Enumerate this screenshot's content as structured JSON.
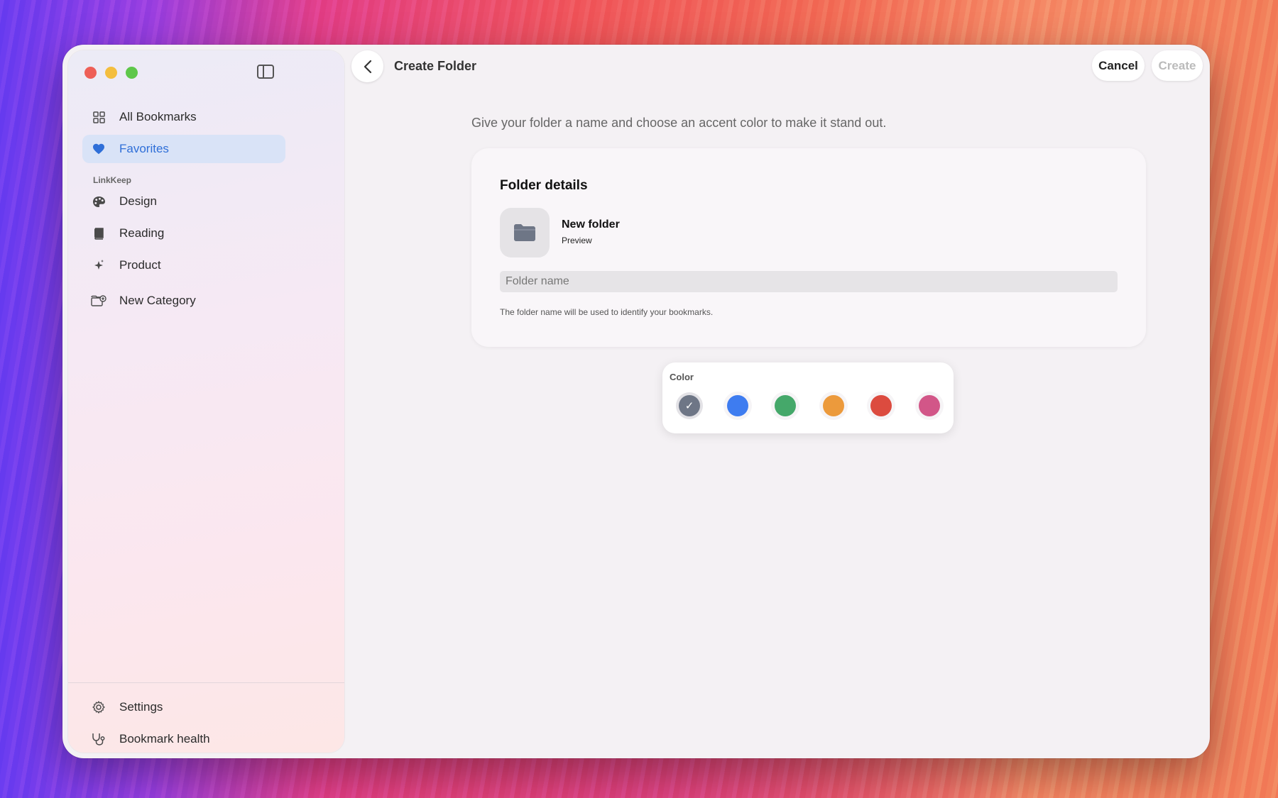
{
  "sidebar": {
    "items": [
      {
        "label": "All Bookmarks",
        "icon": "grid-icon"
      },
      {
        "label": "Favorites",
        "icon": "heart-icon",
        "active": true
      }
    ],
    "section_label": "LinkKeep",
    "categories": [
      {
        "label": "Design",
        "icon": "palette-icon"
      },
      {
        "label": "Reading",
        "icon": "book-icon"
      },
      {
        "label": "Product",
        "icon": "sparkles-icon"
      },
      {
        "label": "New Category",
        "icon": "folder-badge-plus-icon"
      }
    ],
    "footer": [
      {
        "label": "Settings",
        "icon": "gear-icon"
      },
      {
        "label": "Bookmark health",
        "icon": "stethoscope-icon"
      }
    ]
  },
  "header": {
    "title": "Create Folder",
    "cancel_label": "Cancel",
    "create_label": "Create"
  },
  "main": {
    "intro": "Give your folder a name and choose an accent color to make it stand out.",
    "card": {
      "title": "Folder details",
      "preview_name": "New folder",
      "preview_sub": "Preview",
      "input_placeholder": "Folder name",
      "input_value": "",
      "helper": "The folder name will be used to identify your bookmarks."
    },
    "color": {
      "label": "Color",
      "swatches": [
        "#6e7686",
        "#3e7cf0",
        "#45a86a",
        "#ec9a3c",
        "#dc4b3f",
        "#d25688"
      ],
      "selected_index": 0
    }
  },
  "colors": {
    "accent": "#2f6fd8",
    "active_bg": "#d9e3f7"
  }
}
